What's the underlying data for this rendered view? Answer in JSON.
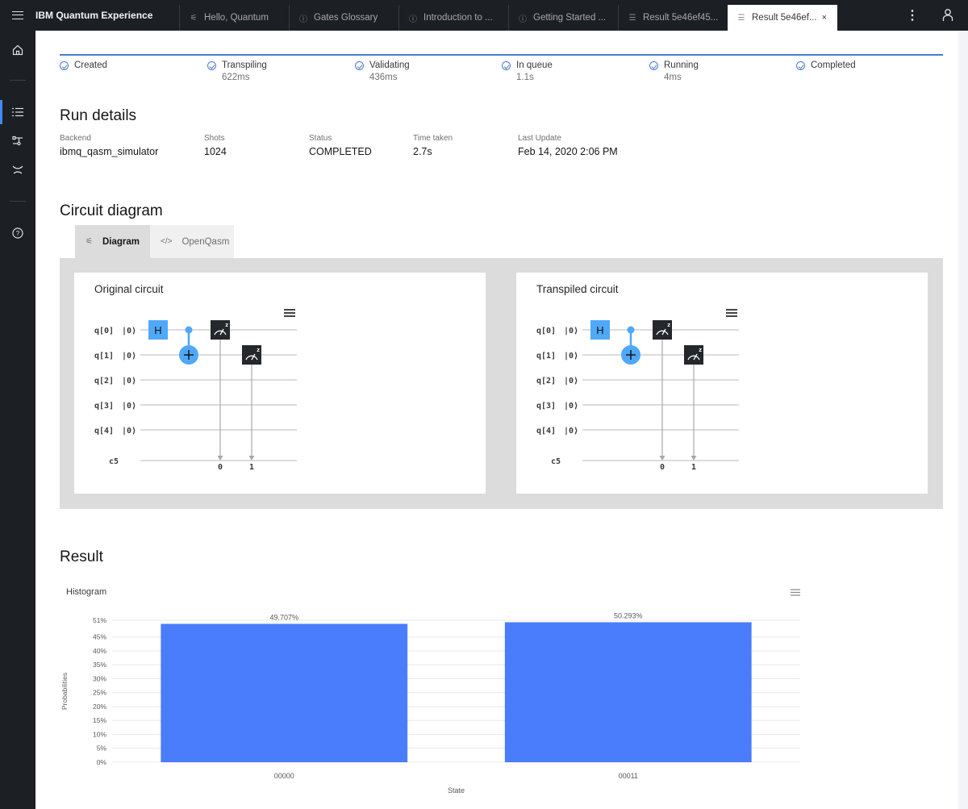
{
  "app": {
    "brand": "IBM Quantum Experience",
    "tabs": [
      {
        "label": "Hello, Quantum",
        "icon": "circuit-icon",
        "active": false
      },
      {
        "label": "Gates Glossary",
        "icon": "help-icon",
        "active": false
      },
      {
        "label": "Introduction to ...",
        "icon": "help-icon",
        "active": false
      },
      {
        "label": "Getting Started ...",
        "icon": "help-icon",
        "active": false
      },
      {
        "label": "Result 5e46ef45...",
        "icon": "list-icon",
        "active": false
      },
      {
        "label": "Result 5e46ef...",
        "icon": "list-icon",
        "active": true
      }
    ],
    "close_glyph": "×",
    "kebab_glyph": "⋮"
  },
  "rail": {
    "items": [
      "home-icon",
      "results-list-icon",
      "circuit-composer-icon",
      "qiskit-notebooks-icon",
      "help-icon"
    ],
    "active": "results-list-icon"
  },
  "progress": {
    "steps": [
      {
        "label": "Created",
        "time": ""
      },
      {
        "label": "Transpiling",
        "time": "622ms"
      },
      {
        "label": "Validating",
        "time": "436ms"
      },
      {
        "label": "In queue",
        "time": "1.1s"
      },
      {
        "label": "Running",
        "time": "4ms"
      },
      {
        "label": "Completed",
        "time": ""
      }
    ]
  },
  "run_details": {
    "heading": "Run details",
    "fields": [
      {
        "label": "Backend",
        "value": "ibmq_qasm_simulator"
      },
      {
        "label": "Shots",
        "value": "1024"
      },
      {
        "label": "Status",
        "value": "COMPLETED"
      },
      {
        "label": "Time taken",
        "value": "2.7s"
      },
      {
        "label": "Last Update",
        "value": "Feb 14, 2020 2:06 PM"
      }
    ]
  },
  "circuit": {
    "heading": "Circuit diagram",
    "tabs": [
      {
        "label": "Diagram",
        "icon": "circuit-icon",
        "active": true
      },
      {
        "label": "OpenQasm",
        "icon": "code-icon",
        "active": false
      }
    ],
    "cards": [
      {
        "title": "Original circuit"
      },
      {
        "title": "Transpiled circuit"
      }
    ],
    "qubits": [
      "q[0]",
      "q[1]",
      "q[2]",
      "q[3]",
      "q[4]"
    ],
    "init_state": "|0⟩",
    "classical": "c5",
    "gates": {
      "h": "H",
      "cnot_control": 0,
      "cnot_target": 1,
      "measure_label": "z"
    },
    "measure_bits": [
      "0",
      "1"
    ],
    "colors": {
      "gate": "#4fa8f8",
      "measure": "#24272b",
      "wire": "#c6c6c6"
    }
  },
  "result": {
    "heading": "Result",
    "histogram_title": "Histogram"
  },
  "chart_data": {
    "type": "bar",
    "title": "Histogram",
    "categories": [
      "00000",
      "00011"
    ],
    "values": [
      49.707,
      50.293
    ],
    "data_labels": [
      "49.707%",
      "50.293%"
    ],
    "xlabel": "State",
    "ylabel": "Probabilities",
    "yticks": [
      "0%",
      "5%",
      "10%",
      "15%",
      "20%",
      "25%",
      "30%",
      "35%",
      "40%",
      "45%",
      "51%"
    ],
    "ytick_values": [
      0,
      5,
      10,
      15,
      20,
      25,
      30,
      35,
      40,
      45,
      51
    ],
    "ylim": [
      0,
      51
    ],
    "grid": true,
    "bar_color": "#4a7dfc"
  }
}
